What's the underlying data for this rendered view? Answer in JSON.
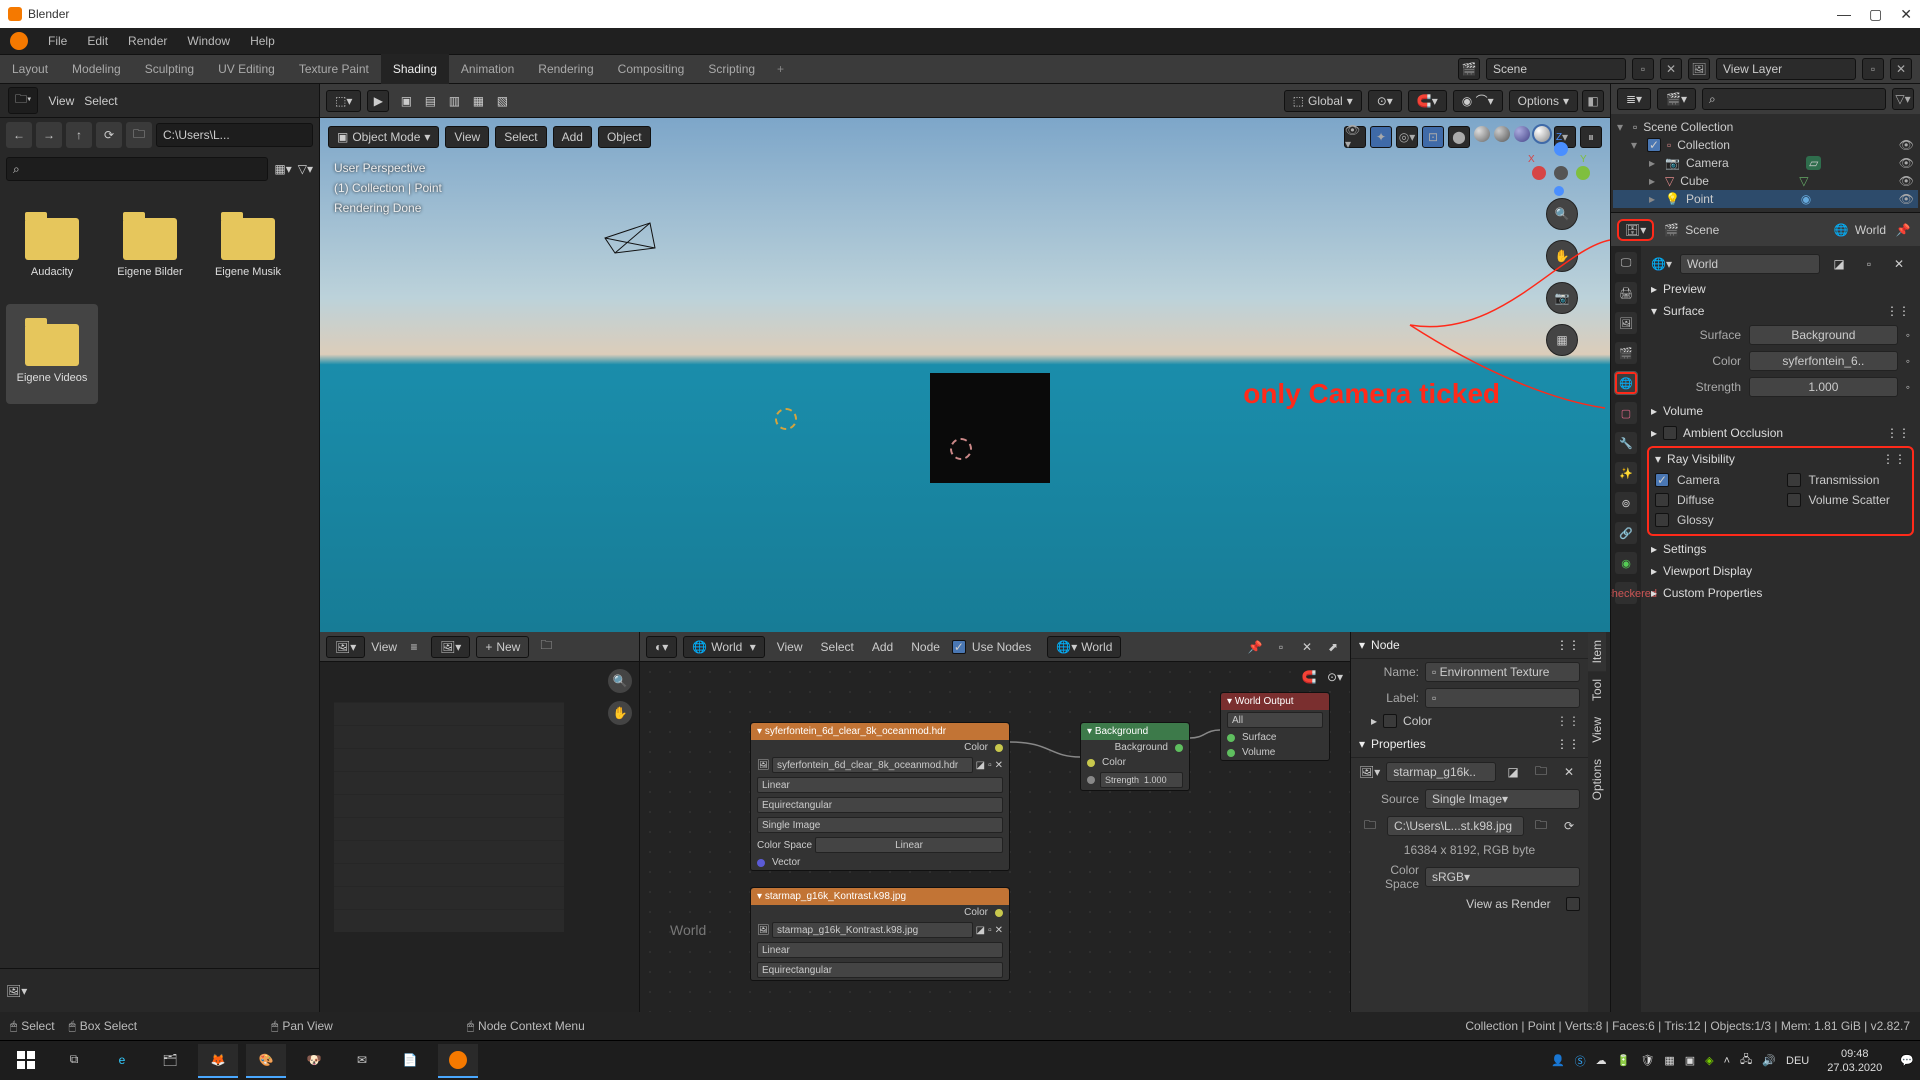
{
  "title": "Blender",
  "menus": [
    "File",
    "Edit",
    "Render",
    "Window",
    "Help"
  ],
  "workspaces": [
    "Layout",
    "Modeling",
    "Sculpting",
    "UV Editing",
    "Texture Paint",
    "Shading",
    "Animation",
    "Rendering",
    "Compositing",
    "Scripting"
  ],
  "active_workspace": "Shading",
  "scene_field": "Scene",
  "viewlayer_field": "View Layer",
  "filebrowser": {
    "head_view": "View",
    "head_select": "Select",
    "path": "C:\\Users\\L...",
    "folders": [
      "Audacity",
      "Eigene Bilder",
      "Eigene Musik",
      "Eigene Videos"
    ],
    "selected": "Eigene Videos",
    "new_btn": "New"
  },
  "viewport": {
    "mode": "Object Mode",
    "menus": [
      "View",
      "Select",
      "Add",
      "Object"
    ],
    "orientation": "Global",
    "options_label": "Options",
    "info_persp": "User Perspective",
    "info_coll": "(1) Collection | Point",
    "info_render": "Rendering Done",
    "annotation": "only Camera ticked"
  },
  "image_editor": {
    "menu_view": "View"
  },
  "node_editor": {
    "scope": "World",
    "menus": [
      "View",
      "Select",
      "Add",
      "Node"
    ],
    "use_nodes_label": "Use Nodes",
    "slot": "World",
    "world_label": "World",
    "nodes": {
      "env1": {
        "title": "syferfontein_6d_clear_8k_oceanmod.hdr",
        "out_color": "Color",
        "file": "syferfontein_6d_clear_8k_oceanmod.hdr",
        "linear": "Linear",
        "proj": "Equirectangular",
        "single": "Single Image",
        "cs_label": "Color Space",
        "cs_value": "Linear",
        "vector": "Vector"
      },
      "env2": {
        "title": "starmap_g16k_Kontrast.k98.jpg",
        "out_color": "Color",
        "file": "starmap_g16k_Kontrast.k98.jpg",
        "linear": "Linear",
        "proj": "Equirectangular"
      },
      "bg": {
        "title": "Background",
        "out": "Background",
        "color": "Color",
        "strength_label": "Strength",
        "strength_val": "1.000"
      },
      "wout": {
        "title": "World Output",
        "all": "All",
        "surface": "Surface",
        "volume": "Volume"
      }
    }
  },
  "node_sidebar": {
    "node_hdr": "Node",
    "name_label": "Name:",
    "name_value": "Environment Texture",
    "label_label": "Label:",
    "color_label": "Color",
    "props_hdr": "Properties",
    "image_name": "starmap_g16k..",
    "source_label": "Source",
    "source_value": "Single Image",
    "filepath": "C:\\Users\\L...st.k98.jpg",
    "dims": "16384 x 8192,  RGB byte",
    "cs_label": "Color Space",
    "cs_value": "sRGB",
    "view_as_render": "View as Render",
    "verttabs": [
      "Item",
      "Tool",
      "View",
      "Options"
    ]
  },
  "outliner": {
    "root": "Scene Collection",
    "collection": "Collection",
    "items": [
      "Camera",
      "Cube",
      "Point"
    ],
    "selected": "Point"
  },
  "properties": {
    "scene_label": "Scene",
    "world_label": "World",
    "world_data": "World",
    "preview": "Preview",
    "surface_hdr": "Surface",
    "surface_label": "Surface",
    "surface_val": "Background",
    "color_label": "Color",
    "color_val": "syferfontein_6..",
    "strength_label": "Strength",
    "strength_val": "1.000",
    "volume": "Volume",
    "ao": "Ambient Occlusion",
    "rayvis_hdr": "Ray Visibility",
    "rayvis": {
      "camera": "Camera",
      "diffuse": "Diffuse",
      "glossy": "Glossy",
      "transmission": "Transmission",
      "volume_scatter": "Volume Scatter"
    },
    "settings": "Settings",
    "vp_display": "Viewport Display",
    "custom_props": "Custom Properties"
  },
  "statusbar": {
    "select": "Select",
    "boxselect": "Box Select",
    "pan": "Pan View",
    "nodemenu": "Node Context Menu",
    "stats": "Collection | Point | Verts:8 | Faces:6 | Tris:12 | Objects:1/3 | Mem: 1.81 GiB | v2.82.7"
  },
  "taskbar": {
    "lang": "DEU",
    "time": "09:48",
    "date": "27.03.2020"
  }
}
